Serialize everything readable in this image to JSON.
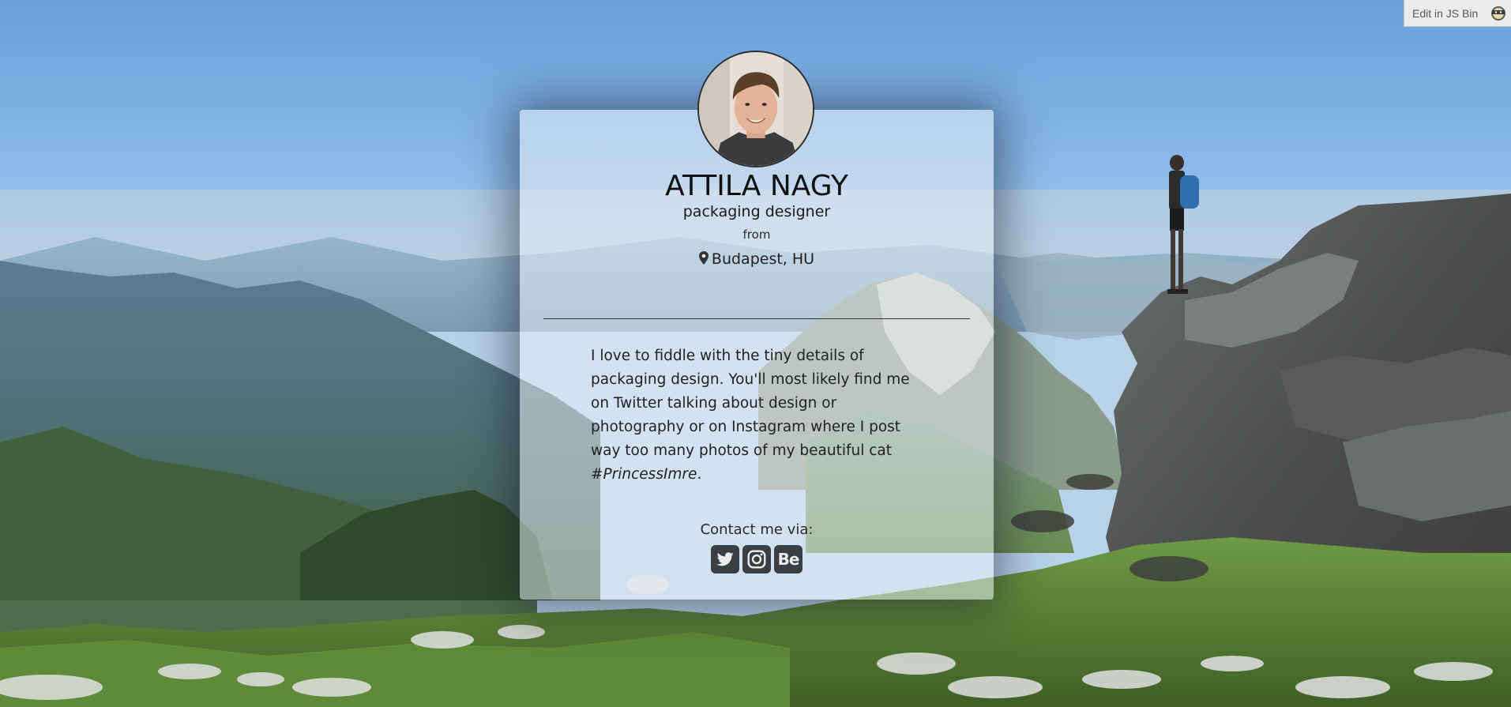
{
  "jsbin": {
    "label": "Edit in JS Bin",
    "icon": "jsbin-ninja-icon"
  },
  "profile": {
    "name": "ATTILA NAGY",
    "job": "packaging designer",
    "from_label": "from",
    "location": "Budapest, HU",
    "location_icon": "map-pin-icon"
  },
  "bio": {
    "lines": [
      "I love to fiddle with the tiny details of",
      "packaging design. You'll most likely find me",
      "on Twitter talking about design or",
      "photography or on Instagram where I post",
      "way too many photos of my beautiful cat"
    ],
    "hashtag": "#PrincessImre",
    "end": "."
  },
  "contact": {
    "label": "Contact me via:",
    "links": [
      {
        "name": "twitter",
        "icon": "twitter-icon"
      },
      {
        "name": "instagram",
        "icon": "instagram-icon"
      },
      {
        "name": "behance",
        "icon": "behance-icon",
        "glyph": "Be"
      }
    ]
  },
  "colors": {
    "card_bg": "#ebf0f5",
    "icon_bg": "#3a3f42",
    "text": "#111111"
  }
}
